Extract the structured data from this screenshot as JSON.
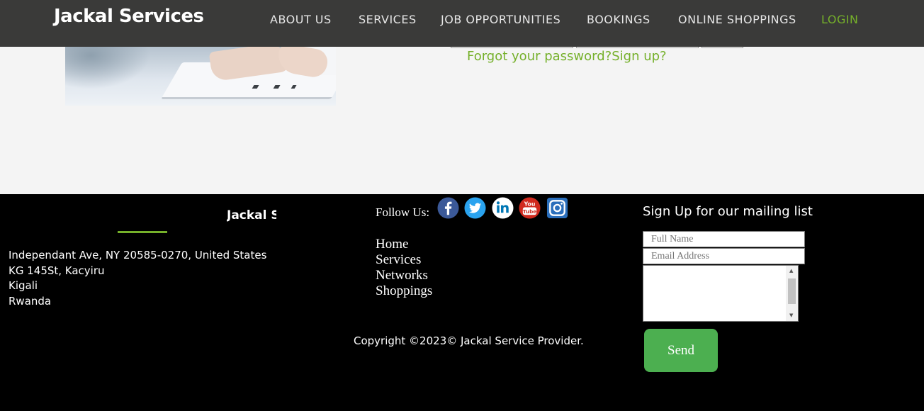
{
  "navbar": {
    "brand": "Jackal Services",
    "links": [
      {
        "label": "ABOUT US"
      },
      {
        "label": "SERVICES"
      },
      {
        "label": "JOB OPPORTUNITIES"
      },
      {
        "label": "BOOKINGS"
      },
      {
        "label": "ONLINE SHOPPINGS"
      },
      {
        "label": "LOGIN"
      }
    ],
    "accent_color": "#75b02a"
  },
  "main": {
    "forgot_password": "Forgot your password?",
    "sign_up": "Sign up?"
  },
  "footer": {
    "brand_clipped": "Jackal Services",
    "address_lines": [
      "Independant Ave, NY 20585-0270, United States",
      "KG 145St, Kacyiru",
      "Kigali",
      "Rwanda"
    ],
    "follow_label": "Follow Us:",
    "social_icons": [
      "facebook-icon",
      "twitter-icon",
      "linkedin-icon",
      "youtube-icon",
      "instagram-icon"
    ],
    "links": [
      "Home",
      "Services",
      "Networks",
      "Shoppings"
    ],
    "copyright": "Copyright ©2023© Jackal Service Provider.",
    "mailing": {
      "title": "Sign Up for our mailing list",
      "full_name_placeholder": "Full Name",
      "email_placeholder": "Email Address",
      "send_label": "Send"
    }
  }
}
